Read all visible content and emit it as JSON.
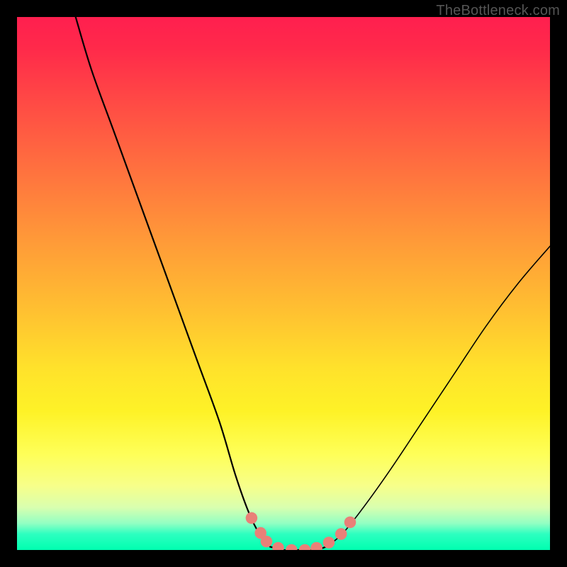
{
  "watermark": "TheBottleneck.com",
  "colors": {
    "background": "#000000",
    "curve_stroke": "#000000",
    "marker_fill": "#e98078",
    "marker_stroke": "#e98078"
  },
  "chart_data": {
    "type": "line",
    "title": "",
    "xlabel": "",
    "ylabel": "",
    "xlim": [
      0,
      100
    ],
    "ylim": [
      0,
      100
    ],
    "note": "V-shaped bottleneck-percentage curve; y=0 at the flat trough around x≈50–58; rises toward 100% on both sides. Values are visual estimates (no numeric axes shown).",
    "series": [
      {
        "name": "left-branch",
        "x": [
          11,
          14,
          18,
          22,
          26,
          30,
          34,
          38,
          41,
          43.5,
          45.5,
          47.5
        ],
        "y": [
          100,
          90,
          79,
          68,
          57,
          46,
          35,
          24,
          14,
          7,
          3,
          0.6
        ]
      },
      {
        "name": "trough",
        "x": [
          47.5,
          50,
          52,
          54,
          56,
          58
        ],
        "y": [
          0.6,
          0,
          0,
          0,
          0,
          0.6
        ]
      },
      {
        "name": "right-branch",
        "x": [
          58,
          61,
          65,
          70,
          76,
          82,
          88,
          94,
          100
        ],
        "y": [
          0.6,
          3,
          8,
          15,
          24,
          33,
          42,
          50,
          57
        ]
      }
    ],
    "markers": {
      "name": "trough-markers",
      "points": [
        {
          "x": 44.0,
          "y": 6.0
        },
        {
          "x": 45.7,
          "y": 3.2
        },
        {
          "x": 46.8,
          "y": 1.6
        },
        {
          "x": 49.0,
          "y": 0.4
        },
        {
          "x": 51.5,
          "y": 0.0
        },
        {
          "x": 54.0,
          "y": 0.0
        },
        {
          "x": 56.2,
          "y": 0.4
        },
        {
          "x": 58.5,
          "y": 1.4
        },
        {
          "x": 60.8,
          "y": 3.0
        },
        {
          "x": 62.5,
          "y": 5.2
        }
      ],
      "radius_pct": 1.1
    }
  }
}
